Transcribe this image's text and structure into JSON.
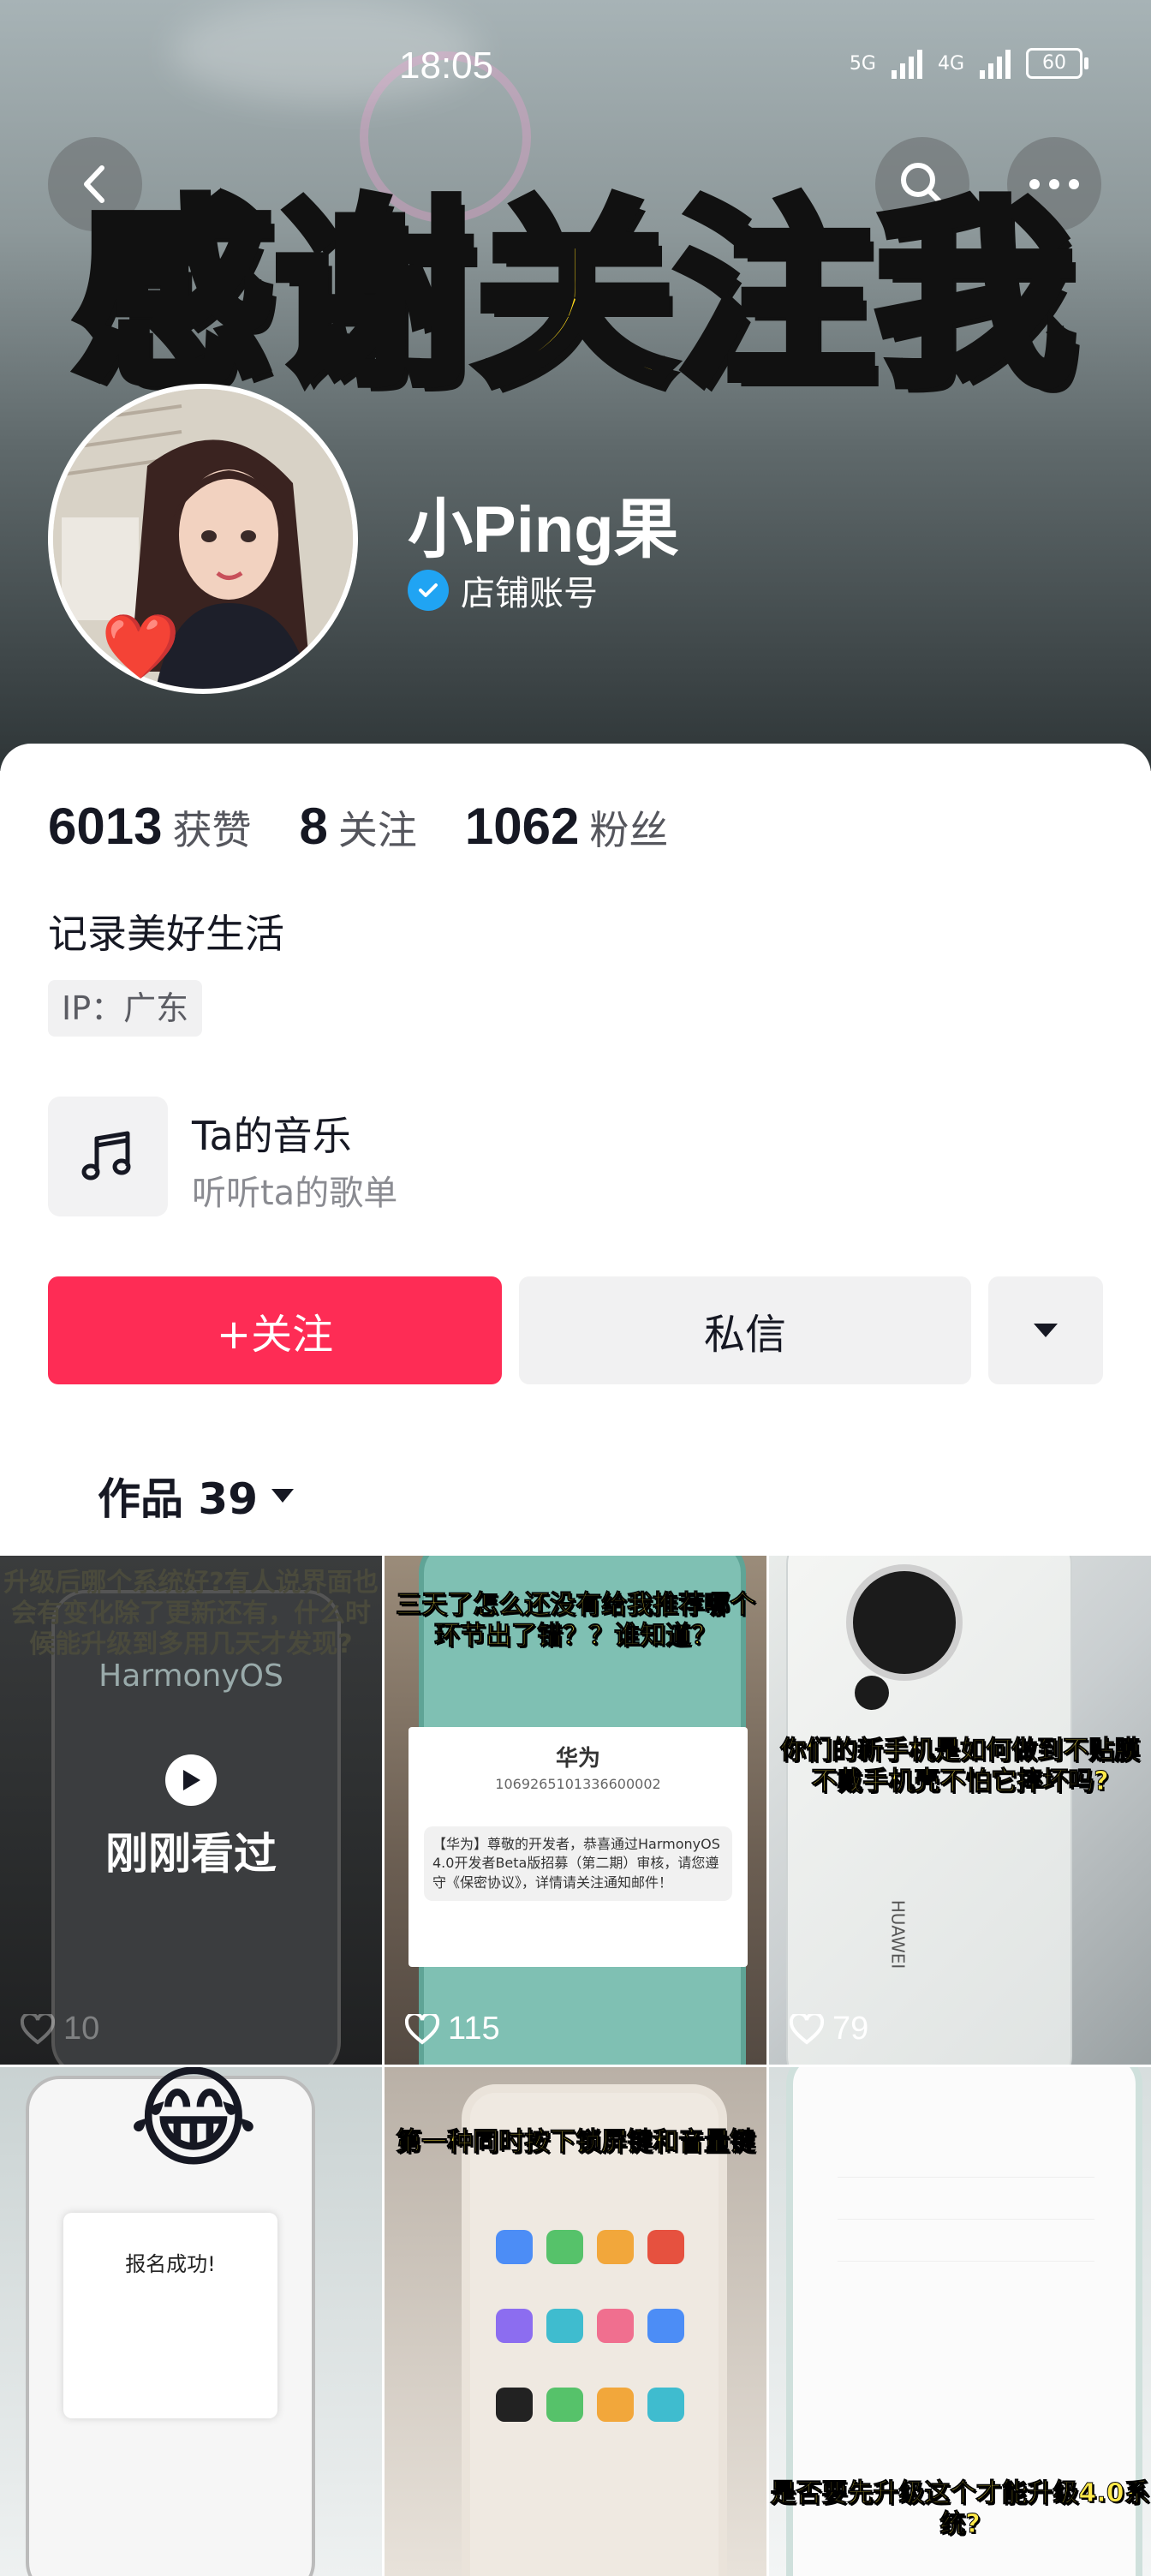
{
  "status_bar": {
    "time": "18:05",
    "net1": "5G",
    "net2": "4G",
    "battery": "60"
  },
  "header": {
    "banner_text": "感谢关注我",
    "username": "小Ping果",
    "account_type": "店铺账号"
  },
  "stats": [
    {
      "value": "6013",
      "label": "获赞"
    },
    {
      "value": "8",
      "label": "关注"
    },
    {
      "value": "1062",
      "label": "粉丝"
    }
  ],
  "bio": "记录美好生活",
  "ip_tag": "IP：广东",
  "music": {
    "title": "Ta的音乐",
    "subtitle": "听听ta的歌单"
  },
  "actions": {
    "follow": "+关注",
    "message": "私信"
  },
  "tab": {
    "label": "作品 39"
  },
  "videos": [
    {
      "caption": "升级后哪个系统好?有人说界面也会有变化除了更新还有，什么时候能升级到多用几天才发现?",
      "likes": "10",
      "watched_label": "刚刚看过",
      "brand": "HarmonyOS"
    },
    {
      "caption": "三天了怎么还没有给我推荐哪个环节出了错？？谁知道？",
      "likes": "115",
      "sms_sender": "华为",
      "sms_number": "1069265101336600002",
      "sms_body": "【华为】尊敬的开发者，恭喜通过HarmonyOS 4.0开发者Beta版招募（第二期）审核，请您遵守《保密协议》，详情请关注通知邮件！"
    },
    {
      "caption": "你们的新手机是如何做到不贴膜不戴手机壳不怕它摔坏吗?",
      "likes": "79",
      "brand": "HUAWEI"
    },
    {
      "caption": "",
      "likes": "",
      "popup": "报名成功!",
      "emoji": "😂"
    },
    {
      "caption": "第一种同时按下锁屏键和音量键",
      "likes": ""
    },
    {
      "caption": "是否要先升级这个才能升级4.0系统?",
      "likes": ""
    }
  ],
  "colors": {
    "follow": "#fe2c55",
    "banner": "#ffd91a",
    "verified": "#20a4f3"
  }
}
